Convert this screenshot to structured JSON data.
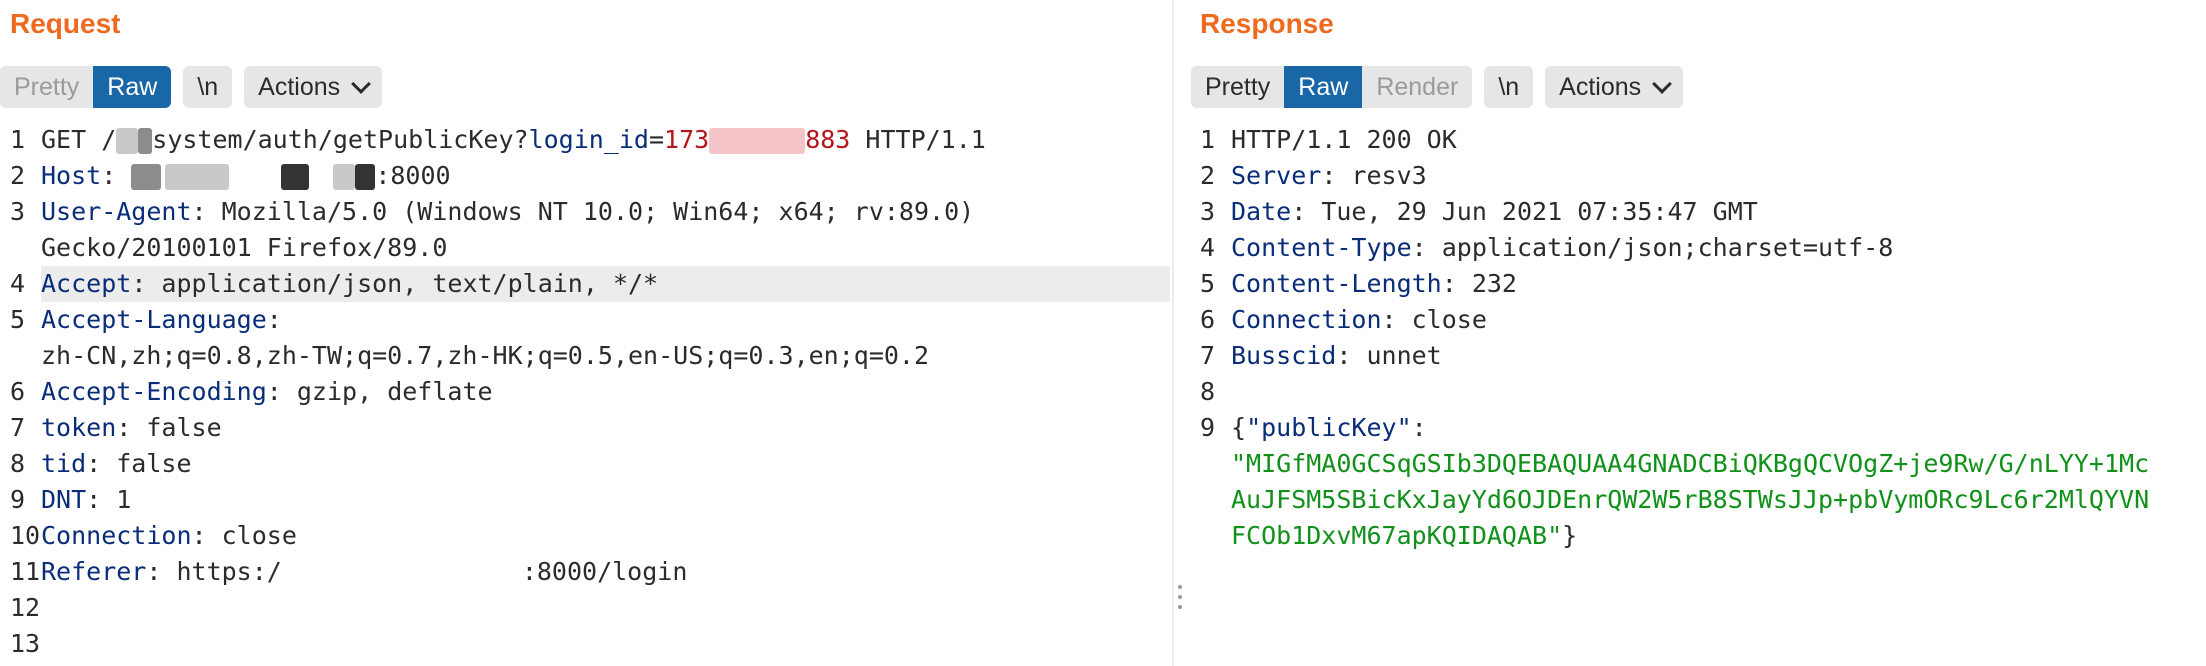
{
  "request": {
    "title": "Request",
    "tabs": [
      {
        "label": "Pretty",
        "active": false
      },
      {
        "label": "Raw",
        "active": true
      }
    ],
    "newline_label": "\\n",
    "actions_label": "Actions",
    "line_numbers": [
      "1",
      "2",
      "3",
      "",
      "4",
      "5",
      "",
      "6",
      "7",
      "8",
      "9",
      "10",
      "11",
      "12",
      "13"
    ],
    "lines": {
      "l1_method": "GET /",
      "l1_path": "system/auth/getPublicKey?",
      "l1_param_key": "login_id",
      "l1_eq": "=",
      "l1_val_start": "173",
      "l1_val_end": "883",
      "l1_proto": " HTTP/1.1",
      "l2_key": "Host",
      "l2_sep": ": ",
      "l2_port": ":8000",
      "l3_key": "User-Agent",
      "l3_val": ": Mozilla/5.0 (Windows NT 10.0; Win64; x64; rv:89.0)",
      "l3_cont": "Gecko/20100101 Firefox/89.0",
      "l4_key": "Accept",
      "l4_val": ": application/json, text/plain, */*",
      "l5_key": "Accept-Language",
      "l5_val": ":",
      "l5_cont": "zh-CN,zh;q=0.8,zh-TW;q=0.7,zh-HK;q=0.5,en-US;q=0.3,en;q=0.2",
      "l6_key": "Accept-Encoding",
      "l6_val": ": gzip, deflate",
      "l7_key": "token",
      "l7_val": ": false",
      "l8_key": "tid",
      "l8_val": ": false",
      "l9_key": "DNT",
      "l9_val": ": 1",
      "l10_key": "Connection",
      "l10_val": ": close",
      "l11_key": "Referer",
      "l11_val_start": ": https:/",
      "l11_val_end": ":8000/login"
    }
  },
  "response": {
    "title": "Response",
    "tabs": [
      {
        "label": "Pretty",
        "active": false
      },
      {
        "label": "Raw",
        "active": true
      },
      {
        "label": "Render",
        "active": false
      }
    ],
    "newline_label": "\\n",
    "actions_label": "Actions",
    "line_numbers": [
      "1",
      "2",
      "3",
      "4",
      "5",
      "6",
      "7",
      "8",
      "9"
    ],
    "lines": {
      "l1": "HTTP/1.1 200 OK",
      "l2_key": "Server",
      "l2_val": ": resv3",
      "l3_key": "Date",
      "l3_val": ": Tue, 29 Jun 2021 07:35:47 GMT",
      "l4_key": "Content-Type",
      "l4_val": ": application/json;charset=utf-8",
      "l5_key": "Content-Length",
      "l5_val": ": 232",
      "l6_key": "Connection",
      "l6_val": ": close",
      "l7_key": "Busscid",
      "l7_val": ": unnet",
      "l9_open": "{",
      "l9_key": "\"publicKey\"",
      "l9_colon": ":",
      "l9_v1": "\"MIGfMA0GCSqGSIb3DQEBAQUAA4GNADCBiQKBgQCVOgZ+je9Rw/G/nLYY+1Mc",
      "l9_v2": "AuJFSM5SBicKxJayYd6OJDEnrQW2W5rB8STWsJJp+pbVymORc9Lc6r2MlQYVN",
      "l9_v3": "FCOb1DxvM67apKQIDAQAB\"",
      "l9_close": "}"
    }
  },
  "colors": {
    "title_orange": "#ef6a1f",
    "active_blue": "#1a67a7",
    "header_key_navy": "#0a2d7a",
    "param_red": "#b5151a",
    "json_green": "#11901a"
  }
}
